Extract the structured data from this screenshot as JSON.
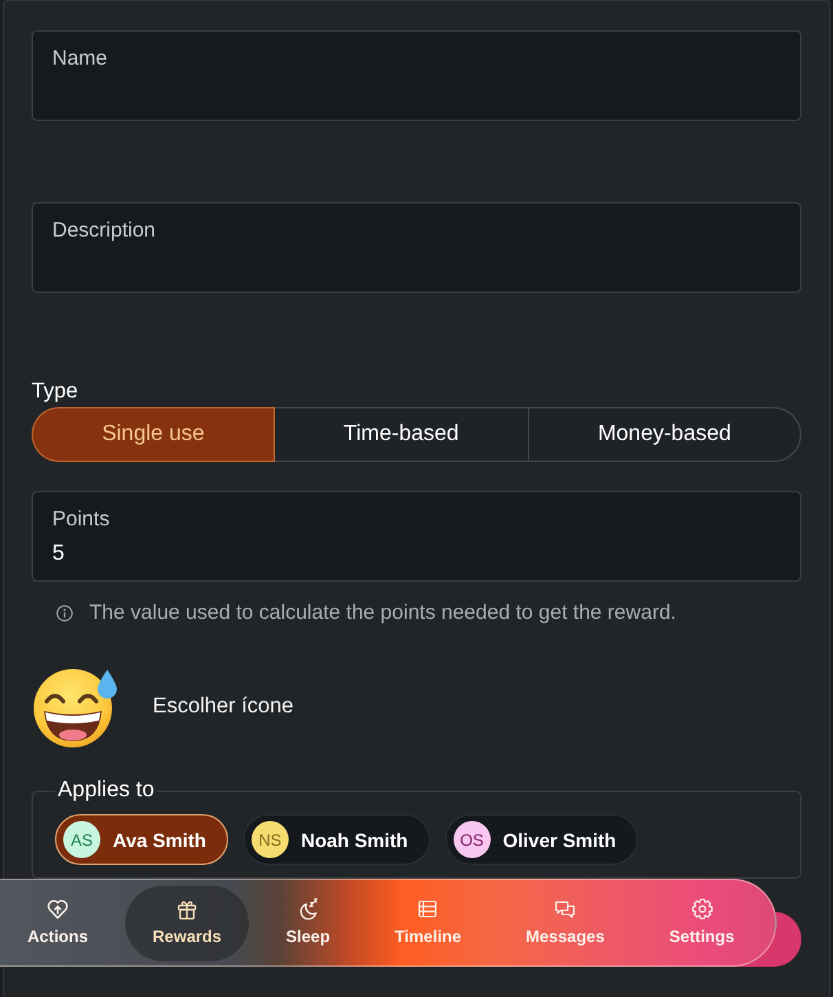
{
  "form": {
    "fields": [
      {
        "label": "Name"
      },
      {
        "label": "Description"
      }
    ],
    "type_selector": {
      "label": "Type",
      "options": [
        {
          "label": "Single use",
          "selected": true
        },
        {
          "label": "Time-based",
          "selected": false
        },
        {
          "label": "Money-based",
          "selected": false
        }
      ]
    },
    "points_field": {
      "label": "Points",
      "value": "5",
      "help": "The value used to calculate the points needed to get the reward."
    },
    "icon_picker": {
      "label": "Escolher ícone"
    },
    "applies_to": {
      "legend": "Applies to",
      "people": [
        {
          "initials": "AS",
          "name": "Ava Smith",
          "selected": true,
          "color": "#c8f5df"
        },
        {
          "initials": "NS",
          "name": "Noah Smith",
          "selected": false,
          "color": "#f7dc6f"
        },
        {
          "initials": "OS",
          "name": "Oliver Smith",
          "selected": false,
          "color": "#f9c6ef"
        }
      ]
    }
  },
  "bottom_nav": {
    "items": [
      {
        "label": "Actions",
        "selected": false
      },
      {
        "label": "Rewards",
        "selected": true
      },
      {
        "label": "Sleep",
        "selected": false
      },
      {
        "label": "Timeline",
        "selected": false
      },
      {
        "label": "Messages",
        "selected": false
      },
      {
        "label": "Settings",
        "selected": false
      }
    ]
  }
}
